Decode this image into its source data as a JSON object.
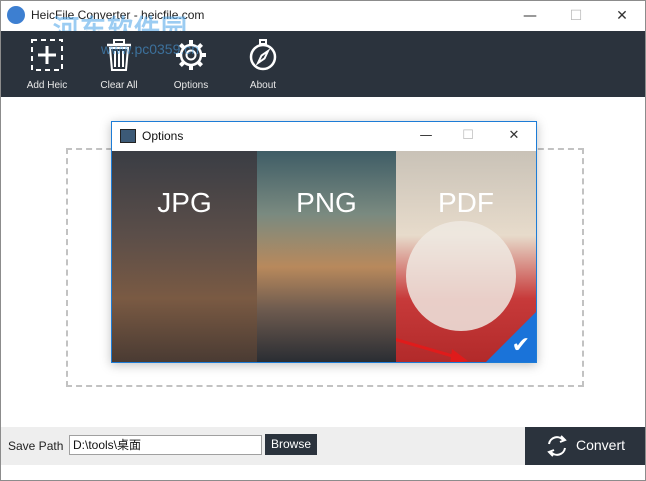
{
  "window": {
    "title": "HeicFile Converter - heicfile.com",
    "watermark": "河东软件园",
    "watermark_url": "www.pc0359.cn",
    "controls": {
      "minimize": "—",
      "maximize": "☐",
      "close": "✕"
    }
  },
  "toolbar": {
    "items": [
      {
        "label": "Add Heic",
        "icon": "add-icon"
      },
      {
        "label": "Clear All",
        "icon": "trash-icon"
      },
      {
        "label": "Options",
        "icon": "gear-icon"
      },
      {
        "label": "About",
        "icon": "compass-icon"
      }
    ]
  },
  "options_dialog": {
    "title": "Options",
    "controls": {
      "minimize": "—",
      "maximize": "☐",
      "close": "✕"
    },
    "formats": [
      {
        "label": "JPG",
        "selected": false
      },
      {
        "label": "PNG",
        "selected": false
      },
      {
        "label": "PDF",
        "selected": true
      }
    ],
    "check": "✔"
  },
  "save_path": {
    "label": "Save Path",
    "value": "D:\\tools\\桌面",
    "browse_label": "Browse"
  },
  "convert": {
    "label": "Convert"
  },
  "colors": {
    "toolbar_bg": "#2b333d",
    "accent": "#1a73d9",
    "dashed_border": "#c2c2c2"
  }
}
